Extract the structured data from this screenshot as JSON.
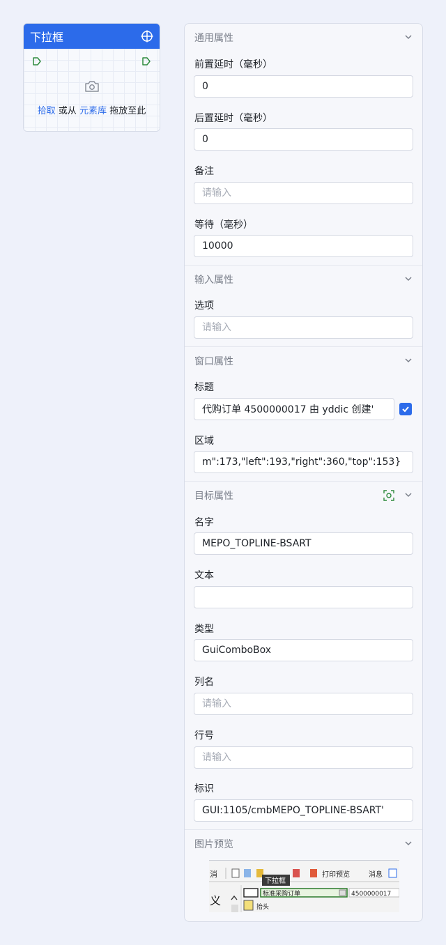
{
  "component": {
    "title": "下拉框",
    "pick_link": "拾取",
    "or_from": "或从",
    "library_link": "元素库",
    "drag_here": "拖放至此"
  },
  "sections": {
    "general": "通用属性",
    "input": "输入属性",
    "window": "窗口属性",
    "target": "目标属性",
    "preview": "图片预览"
  },
  "general": {
    "pre_delay_label": "前置延时（毫秒）",
    "pre_delay_value": "0",
    "post_delay_label": "后置延时（毫秒）",
    "post_delay_value": "0",
    "note_label": "备注",
    "note_placeholder": "请输入",
    "wait_label": "等待（毫秒）",
    "wait_value": "10000"
  },
  "input": {
    "option_label": "选项",
    "option_placeholder": "请输入"
  },
  "window": {
    "title_label": "标题",
    "title_value": "代购订单 4500000017 由 yddic 创建'",
    "title_checked": true,
    "region_label": "区域",
    "region_value": "m\":173,\"left\":193,\"right\":360,\"top\":153}"
  },
  "target": {
    "name_label": "名字",
    "name_value": "MEPO_TOPLINE-BSART",
    "text_label": "文本",
    "text_value": "",
    "type_label": "类型",
    "type_value": "GuiComboBox",
    "colname_label": "列名",
    "colname_placeholder": "请输入",
    "row_label": "行号",
    "row_placeholder": "请输入",
    "id_label": "标识",
    "id_value": "GUI:1105/cmbMEPO_TOPLINE-BSART'"
  },
  "preview_image": {
    "toolbar_text_1": "消",
    "toolbar_text_2": "打印预览",
    "toolbar_text_3": "消息",
    "tooltip": "下拉框",
    "combo_value": "标准采购订单",
    "po_number": "4500000017",
    "left_char": "义",
    "row2_text": "抬头"
  },
  "colors": {
    "accent": "#2c6bea",
    "port_green": "#2e8b3e",
    "background": "#eef1fa"
  }
}
